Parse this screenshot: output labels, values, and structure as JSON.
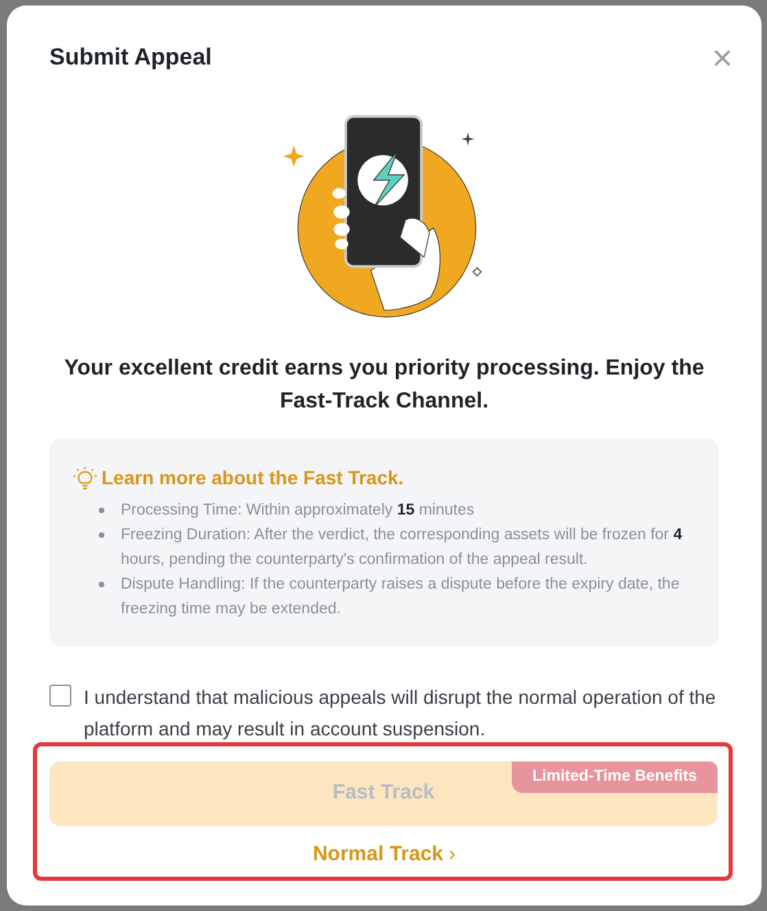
{
  "dialog": {
    "title": "Submit Appeal",
    "close": "×",
    "headline": "Your excellent credit earns you priority processing. Enjoy the Fast-Track Channel.",
    "info": {
      "heading": "Learn more about the Fast Track.",
      "items": [
        "Processing Time: Within approximately **15** minutes",
        "Freezing Duration: After the verdict, the corresponding assets will be frozen for **4** hours, pending the counterparty's confirmation of the appeal result.",
        "Dispute Handling: If the counterparty raises a dispute before the expiry date, the freezing time may be extended."
      ]
    },
    "agreement": {
      "label": "I understand that malicious appeals will disrupt the normal operation of the platform and may result in account suspension.",
      "checked": false
    },
    "fast_track": {
      "label": "Fast Track",
      "badge": "Limited-Time Benefits",
      "disabled": true
    },
    "normal_track": {
      "label": "Normal Track",
      "caret": "›"
    },
    "highlight": true
  }
}
